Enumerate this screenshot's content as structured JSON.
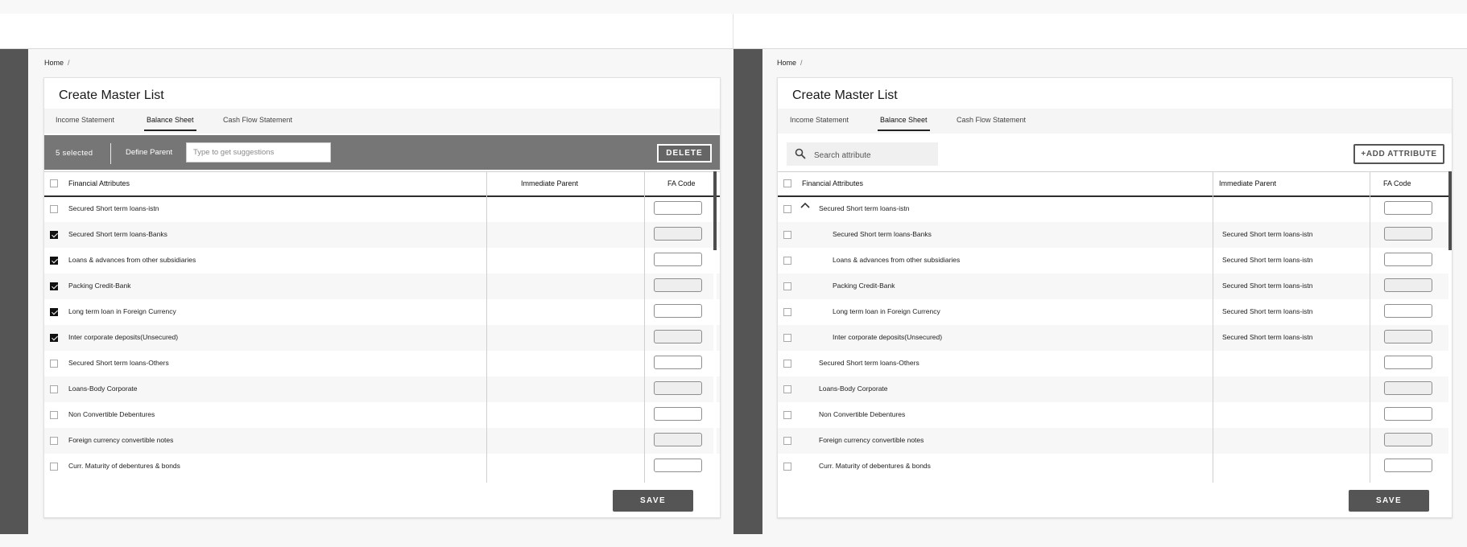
{
  "left": {
    "breadcrumb": {
      "home": "Home",
      "sep": "/"
    },
    "card": {
      "title": "Create Master List"
    },
    "tabs": [
      {
        "label": "Income Statement",
        "active": false
      },
      {
        "label": "Balance Sheet",
        "active": true
      },
      {
        "label": "Cash Flow Statement",
        "active": false
      }
    ],
    "actionbar": {
      "selected": "5 selected",
      "define_parent": "Define Parent",
      "suggest_placeholder": "Type to get suggestions",
      "delete": "DELETE"
    },
    "table": {
      "headers": {
        "attr": "Financial Attributes",
        "parent": "Immediate Parent",
        "fa": "FA Code"
      },
      "rows": [
        {
          "attr": "Secured Short term loans-istn",
          "checked": false,
          "parent": "",
          "fa": ""
        },
        {
          "attr": "Secured Short term loans-Banks",
          "checked": true,
          "parent": "",
          "fa": ""
        },
        {
          "attr": "Loans & advances from other subsidiaries",
          "checked": true,
          "parent": "",
          "fa": ""
        },
        {
          "attr": "Packing Credit-Bank",
          "checked": true,
          "parent": "",
          "fa": ""
        },
        {
          "attr": "Long term loan in Foreign Currency",
          "checked": true,
          "parent": "",
          "fa": ""
        },
        {
          "attr": "Inter corporate deposits(Unsecured)",
          "checked": true,
          "parent": "",
          "fa": ""
        },
        {
          "attr": "Secured Short term loans-Others",
          "checked": false,
          "parent": "",
          "fa": ""
        },
        {
          "attr": "Loans-Body Corporate",
          "checked": false,
          "parent": "",
          "fa": ""
        },
        {
          "attr": "Non Convertible Debentures",
          "checked": false,
          "parent": "",
          "fa": ""
        },
        {
          "attr": "Foreign currency convertible notes",
          "checked": false,
          "parent": "",
          "fa": ""
        },
        {
          "attr": "Curr. Maturity of debentures & bonds",
          "checked": false,
          "parent": "",
          "fa": ""
        }
      ]
    },
    "save": "SAVE"
  },
  "right": {
    "breadcrumb": {
      "home": "Home",
      "sep": "/"
    },
    "card": {
      "title": "Create Master List"
    },
    "tabs": [
      {
        "label": "Income Statement",
        "active": false
      },
      {
        "label": "Balance Sheet",
        "active": true
      },
      {
        "label": "Cash Flow Statement",
        "active": false
      }
    ],
    "search": {
      "placeholder": "Search attribute",
      "icon": "search-icon"
    },
    "add_attribute": "+ADD ATTRIBUTE",
    "table": {
      "headers": {
        "attr": "Financial Attributes",
        "parent": "Immediate Parent",
        "fa": "FA Code"
      },
      "rows": [
        {
          "attr": "Secured Short term loans-istn",
          "checked": false,
          "expanded": true,
          "child": false,
          "parent": "",
          "fa": ""
        },
        {
          "attr": "Secured Short term loans-Banks",
          "checked": false,
          "child": true,
          "parent": "Secured Short term loans-istn",
          "fa": ""
        },
        {
          "attr": "Loans & advances from other subsidiaries",
          "checked": false,
          "child": true,
          "parent": "Secured Short term loans-istn",
          "fa": ""
        },
        {
          "attr": "Packing Credit-Bank",
          "checked": false,
          "child": true,
          "parent": "Secured Short term loans-istn",
          "fa": ""
        },
        {
          "attr": "Long term loan in Foreign Currency",
          "checked": false,
          "child": true,
          "parent": "Secured Short term loans-istn",
          "fa": ""
        },
        {
          "attr": "Inter corporate deposits(Unsecured)",
          "checked": false,
          "child": true,
          "parent": "Secured Short term loans-istn",
          "fa": ""
        },
        {
          "attr": "Secured Short term loans-Others",
          "checked": false,
          "child": false,
          "parent": "",
          "fa": ""
        },
        {
          "attr": "Loans-Body Corporate",
          "checked": false,
          "child": false,
          "parent": "",
          "fa": ""
        },
        {
          "attr": "Non Convertible Debentures",
          "checked": false,
          "child": false,
          "parent": "",
          "fa": ""
        },
        {
          "attr": "Foreign currency convertible notes",
          "checked": false,
          "child": false,
          "parent": "",
          "fa": ""
        },
        {
          "attr": "Curr. Maturity of debentures & bonds",
          "checked": false,
          "child": false,
          "parent": "",
          "fa": ""
        }
      ]
    },
    "save": "SAVE"
  }
}
